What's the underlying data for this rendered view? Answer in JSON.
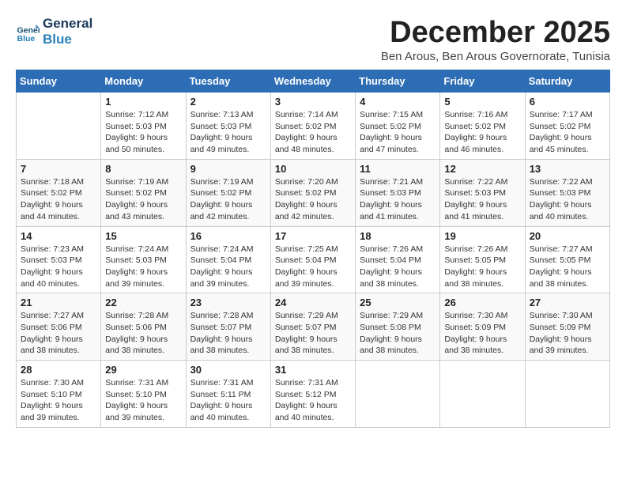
{
  "header": {
    "logo_line1": "General",
    "logo_line2": "Blue",
    "month_title": "December 2025",
    "location": "Ben Arous, Ben Arous Governorate, Tunisia"
  },
  "weekdays": [
    "Sunday",
    "Monday",
    "Tuesday",
    "Wednesday",
    "Thursday",
    "Friday",
    "Saturday"
  ],
  "weeks": [
    [
      {
        "day": "",
        "info": ""
      },
      {
        "day": "1",
        "info": "Sunrise: 7:12 AM\nSunset: 5:03 PM\nDaylight: 9 hours\nand 50 minutes."
      },
      {
        "day": "2",
        "info": "Sunrise: 7:13 AM\nSunset: 5:03 PM\nDaylight: 9 hours\nand 49 minutes."
      },
      {
        "day": "3",
        "info": "Sunrise: 7:14 AM\nSunset: 5:02 PM\nDaylight: 9 hours\nand 48 minutes."
      },
      {
        "day": "4",
        "info": "Sunrise: 7:15 AM\nSunset: 5:02 PM\nDaylight: 9 hours\nand 47 minutes."
      },
      {
        "day": "5",
        "info": "Sunrise: 7:16 AM\nSunset: 5:02 PM\nDaylight: 9 hours\nand 46 minutes."
      },
      {
        "day": "6",
        "info": "Sunrise: 7:17 AM\nSunset: 5:02 PM\nDaylight: 9 hours\nand 45 minutes."
      }
    ],
    [
      {
        "day": "7",
        "info": "Sunrise: 7:18 AM\nSunset: 5:02 PM\nDaylight: 9 hours\nand 44 minutes."
      },
      {
        "day": "8",
        "info": "Sunrise: 7:19 AM\nSunset: 5:02 PM\nDaylight: 9 hours\nand 43 minutes."
      },
      {
        "day": "9",
        "info": "Sunrise: 7:19 AM\nSunset: 5:02 PM\nDaylight: 9 hours\nand 42 minutes."
      },
      {
        "day": "10",
        "info": "Sunrise: 7:20 AM\nSunset: 5:02 PM\nDaylight: 9 hours\nand 42 minutes."
      },
      {
        "day": "11",
        "info": "Sunrise: 7:21 AM\nSunset: 5:03 PM\nDaylight: 9 hours\nand 41 minutes."
      },
      {
        "day": "12",
        "info": "Sunrise: 7:22 AM\nSunset: 5:03 PM\nDaylight: 9 hours\nand 41 minutes."
      },
      {
        "day": "13",
        "info": "Sunrise: 7:22 AM\nSunset: 5:03 PM\nDaylight: 9 hours\nand 40 minutes."
      }
    ],
    [
      {
        "day": "14",
        "info": "Sunrise: 7:23 AM\nSunset: 5:03 PM\nDaylight: 9 hours\nand 40 minutes."
      },
      {
        "day": "15",
        "info": "Sunrise: 7:24 AM\nSunset: 5:03 PM\nDaylight: 9 hours\nand 39 minutes."
      },
      {
        "day": "16",
        "info": "Sunrise: 7:24 AM\nSunset: 5:04 PM\nDaylight: 9 hours\nand 39 minutes."
      },
      {
        "day": "17",
        "info": "Sunrise: 7:25 AM\nSunset: 5:04 PM\nDaylight: 9 hours\nand 39 minutes."
      },
      {
        "day": "18",
        "info": "Sunrise: 7:26 AM\nSunset: 5:04 PM\nDaylight: 9 hours\nand 38 minutes."
      },
      {
        "day": "19",
        "info": "Sunrise: 7:26 AM\nSunset: 5:05 PM\nDaylight: 9 hours\nand 38 minutes."
      },
      {
        "day": "20",
        "info": "Sunrise: 7:27 AM\nSunset: 5:05 PM\nDaylight: 9 hours\nand 38 minutes."
      }
    ],
    [
      {
        "day": "21",
        "info": "Sunrise: 7:27 AM\nSunset: 5:06 PM\nDaylight: 9 hours\nand 38 minutes."
      },
      {
        "day": "22",
        "info": "Sunrise: 7:28 AM\nSunset: 5:06 PM\nDaylight: 9 hours\nand 38 minutes."
      },
      {
        "day": "23",
        "info": "Sunrise: 7:28 AM\nSunset: 5:07 PM\nDaylight: 9 hours\nand 38 minutes."
      },
      {
        "day": "24",
        "info": "Sunrise: 7:29 AM\nSunset: 5:07 PM\nDaylight: 9 hours\nand 38 minutes."
      },
      {
        "day": "25",
        "info": "Sunrise: 7:29 AM\nSunset: 5:08 PM\nDaylight: 9 hours\nand 38 minutes."
      },
      {
        "day": "26",
        "info": "Sunrise: 7:30 AM\nSunset: 5:09 PM\nDaylight: 9 hours\nand 38 minutes."
      },
      {
        "day": "27",
        "info": "Sunrise: 7:30 AM\nSunset: 5:09 PM\nDaylight: 9 hours\nand 39 minutes."
      }
    ],
    [
      {
        "day": "28",
        "info": "Sunrise: 7:30 AM\nSunset: 5:10 PM\nDaylight: 9 hours\nand 39 minutes."
      },
      {
        "day": "29",
        "info": "Sunrise: 7:31 AM\nSunset: 5:10 PM\nDaylight: 9 hours\nand 39 minutes."
      },
      {
        "day": "30",
        "info": "Sunrise: 7:31 AM\nSunset: 5:11 PM\nDaylight: 9 hours\nand 40 minutes."
      },
      {
        "day": "31",
        "info": "Sunrise: 7:31 AM\nSunset: 5:12 PM\nDaylight: 9 hours\nand 40 minutes."
      },
      {
        "day": "",
        "info": ""
      },
      {
        "day": "",
        "info": ""
      },
      {
        "day": "",
        "info": ""
      }
    ]
  ]
}
